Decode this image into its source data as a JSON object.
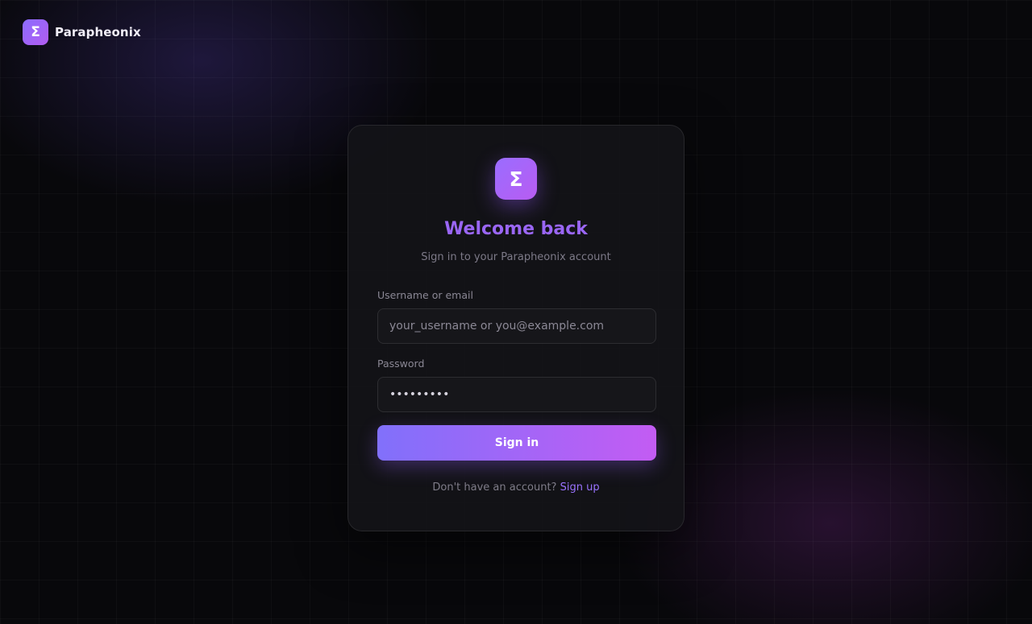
{
  "brand": {
    "logo_glyph": "Σ",
    "name": "Parapheonix"
  },
  "card": {
    "logo_glyph": "Σ",
    "title": "Welcome back",
    "subtitle": "Sign in to your Parapheonix account"
  },
  "form": {
    "username_label": "Username or email",
    "username_placeholder": "your_username or you@example.com",
    "password_label": "Password",
    "password_value": "password1",
    "submit_label": "Sign in"
  },
  "footer": {
    "prompt": "Don't have an account?",
    "link_label": "Sign up"
  },
  "colors": {
    "accent": "#9a66f5",
    "gradient_start": "#8170fb",
    "gradient_end": "#c35cf3",
    "background": "#08080b"
  }
}
